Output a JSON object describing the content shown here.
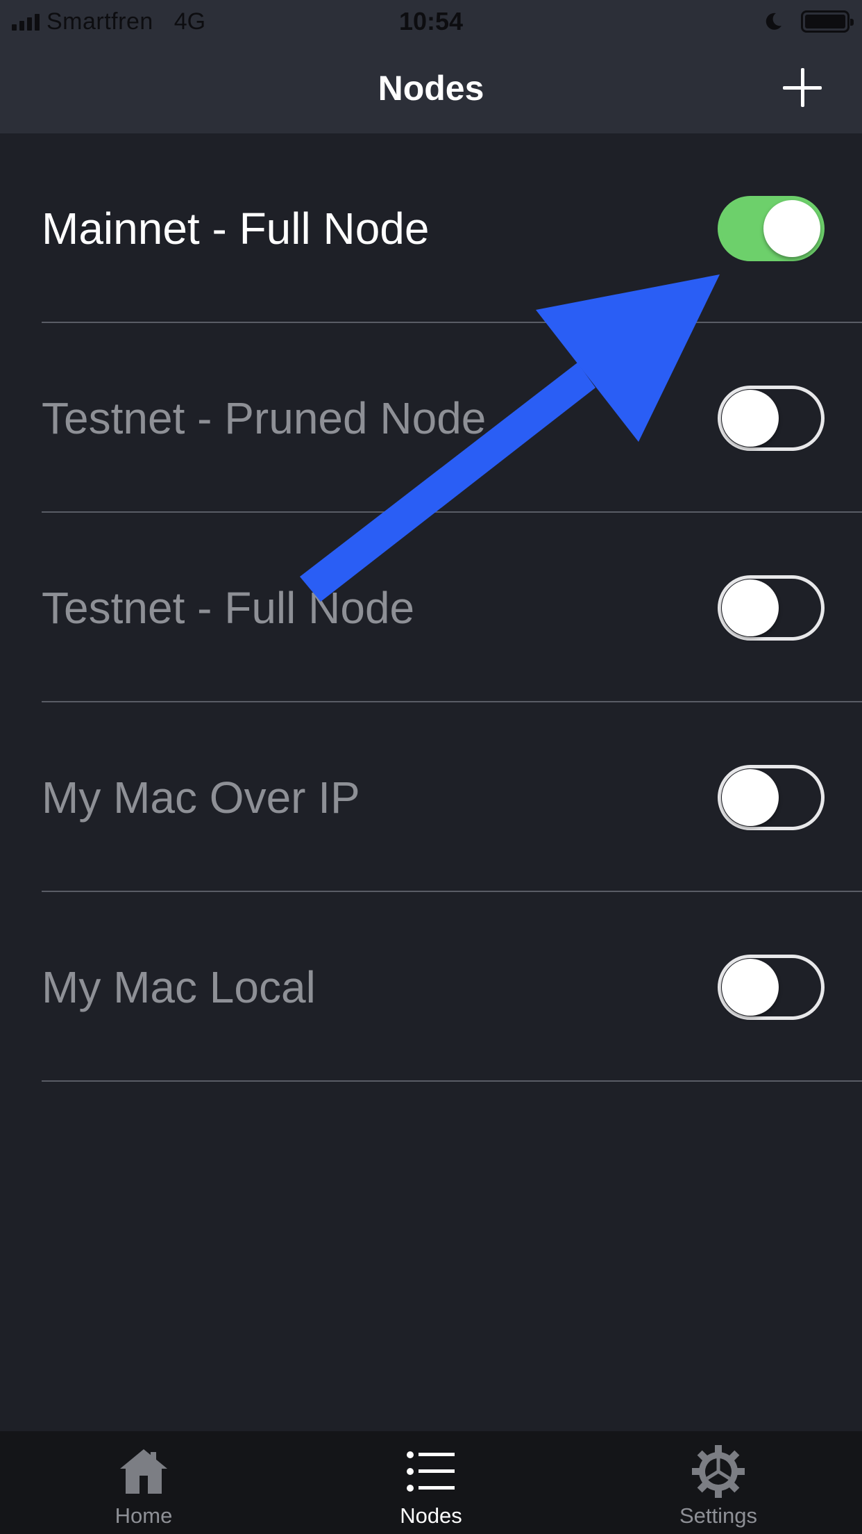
{
  "status_bar": {
    "carrier": "Smartfren",
    "network": "4G",
    "time": "10:54"
  },
  "nav": {
    "title": "Nodes",
    "add_icon": "plus-icon"
  },
  "nodes": [
    {
      "label": "Mainnet - Full Node",
      "enabled": true
    },
    {
      "label": "Testnet - Pruned Node",
      "enabled": false
    },
    {
      "label": "Testnet - Full Node",
      "enabled": false
    },
    {
      "label": "My Mac Over IP",
      "enabled": false
    },
    {
      "label": "My Mac Local",
      "enabled": false
    }
  ],
  "tab_bar": {
    "tabs": [
      {
        "label": "Home",
        "icon": "house-icon",
        "selected": false
      },
      {
        "label": "Nodes",
        "icon": "list-icon",
        "selected": true
      },
      {
        "label": "Settings",
        "icon": "gear-icon",
        "selected": false
      }
    ]
  },
  "colors": {
    "background": "#1e2027",
    "bar": "#2c2f38",
    "toggle_on": "#6dd06b",
    "annotation_arrow": "#2a5ef5"
  }
}
